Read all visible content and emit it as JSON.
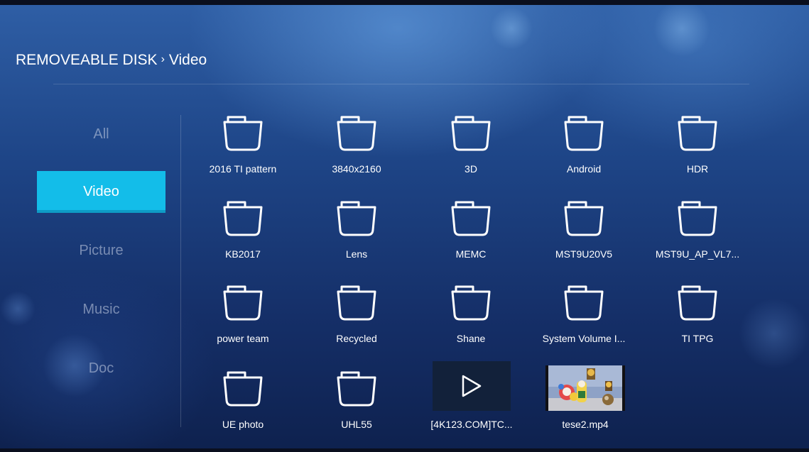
{
  "breadcrumb": {
    "root": "REMOVEABLE DISK",
    "separator": "›",
    "current": "Video"
  },
  "sidebar": {
    "items": [
      {
        "label": "All",
        "active": false
      },
      {
        "label": "Video",
        "active": true
      },
      {
        "label": "Picture",
        "active": false
      },
      {
        "label": "Music",
        "active": false
      },
      {
        "label": "Doc",
        "active": false
      }
    ]
  },
  "files": [
    {
      "name": "2016 TI pattern",
      "type": "folder",
      "icon": "folder-icon"
    },
    {
      "name": "3840x2160",
      "type": "folder",
      "icon": "folder-icon"
    },
    {
      "name": "3D",
      "type": "folder",
      "icon": "folder-icon"
    },
    {
      "name": "Android",
      "type": "folder",
      "icon": "folder-icon"
    },
    {
      "name": "HDR",
      "type": "folder",
      "icon": "folder-icon"
    },
    {
      "name": "KB2017",
      "type": "folder",
      "icon": "folder-icon"
    },
    {
      "name": "Lens",
      "type": "folder",
      "icon": "folder-icon"
    },
    {
      "name": "MEMC",
      "type": "folder",
      "icon": "folder-icon"
    },
    {
      "name": "MST9U20V5",
      "type": "folder",
      "icon": "folder-icon"
    },
    {
      "name": "MST9U_AP_VL7...",
      "type": "folder",
      "icon": "folder-icon"
    },
    {
      "name": "power team",
      "type": "folder",
      "icon": "folder-icon"
    },
    {
      "name": "Recycled",
      "type": "folder",
      "icon": "folder-icon"
    },
    {
      "name": "Shane",
      "type": "folder",
      "icon": "folder-icon"
    },
    {
      "name": "System Volume I...",
      "type": "folder",
      "icon": "folder-icon"
    },
    {
      "name": "TI TPG",
      "type": "folder",
      "icon": "folder-icon"
    },
    {
      "name": "UE photo",
      "type": "folder",
      "icon": "folder-icon"
    },
    {
      "name": "UHL55",
      "type": "folder",
      "icon": "folder-icon"
    },
    {
      "name": "[4K123.COM]TC...",
      "type": "video",
      "icon": "play-icon"
    },
    {
      "name": "tese2.mp4",
      "type": "video-thumbnail",
      "icon": "video-thumbnail"
    }
  ],
  "colors": {
    "accent": "#13bde9",
    "background_top": "#2f5fa6",
    "background_bottom": "#0e214e",
    "inactive_text": "#c8d2e6"
  }
}
